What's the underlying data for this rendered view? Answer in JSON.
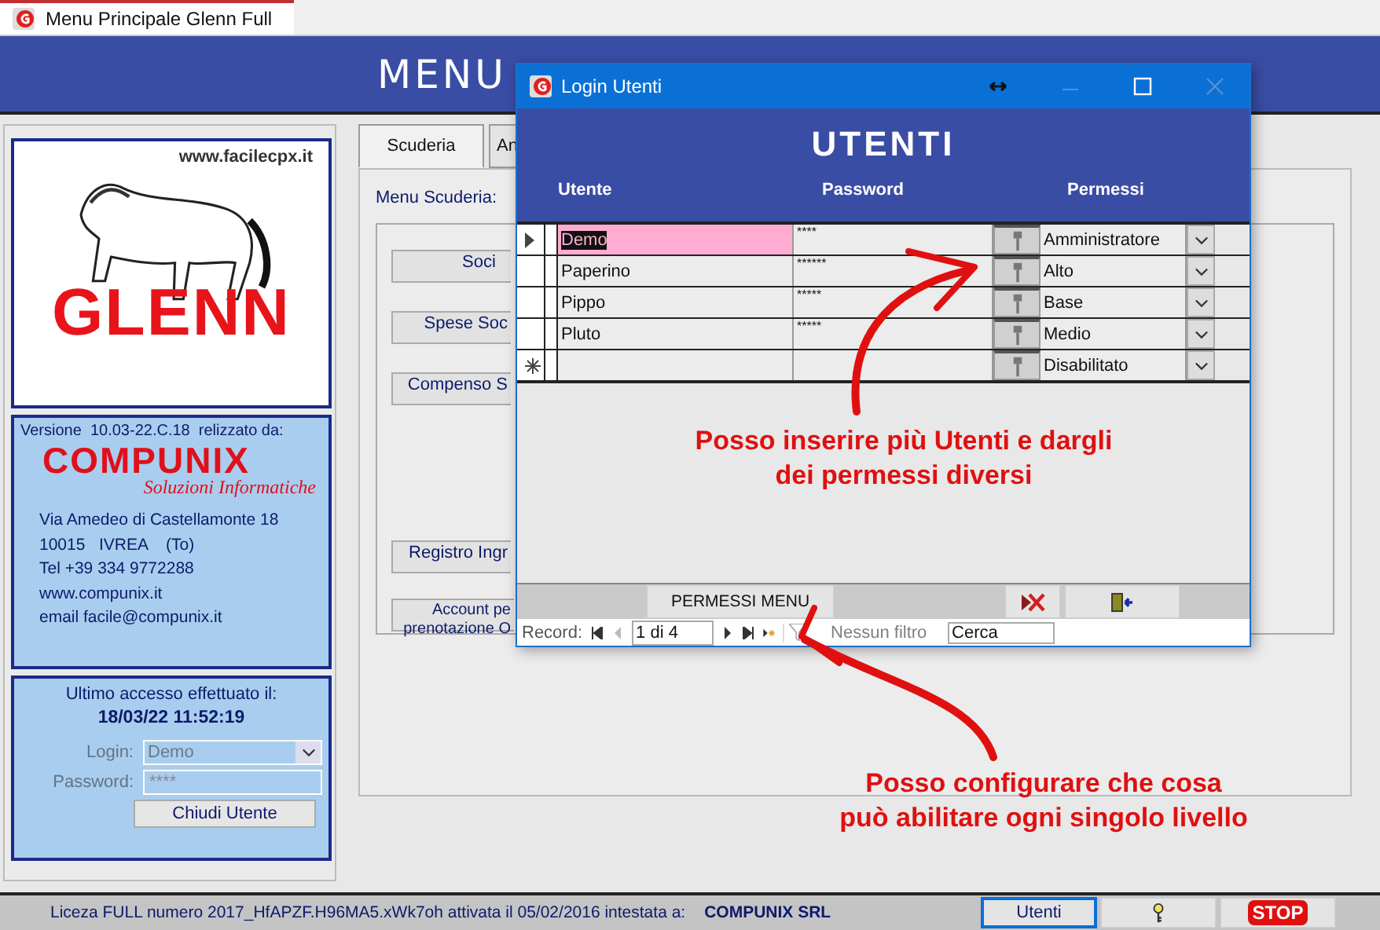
{
  "window": {
    "tab_title": "Menu Principale Glenn Full",
    "header": "MENU"
  },
  "sidebar": {
    "logo": {
      "url": "www.facilecpx.it",
      "name": "GLENN"
    },
    "info": {
      "version": "Versione  10.03-22.C.18  relizzato da:",
      "company": "COMPUNIX",
      "tagline": "Soluzioni Informatiche",
      "address_lines": [
        "Via Amedeo di Castellamonte 18",
        "10015   IVREA    (To)",
        "Tel +39 334 9772288",
        "www.compunix.it",
        "email facile@compunix.it"
      ]
    },
    "last_access": {
      "label": "Ultimo accesso effettuato il:",
      "datetime": "18/03/22 11:52:19",
      "login_label": "Login:",
      "login_value": "Demo",
      "password_label": "Password:",
      "password_value": "****",
      "disabled": true,
      "close_button": "Chiudi Utente"
    }
  },
  "tabs": [
    {
      "label": "Scuderia",
      "selected": true
    },
    {
      "label": "An",
      "selected": false
    }
  ],
  "menu": {
    "title": "Menu Scuderia:",
    "buttons": [
      {
        "lines": [
          "Soci"
        ]
      },
      {
        "lines": [
          "Spese Soc"
        ]
      },
      {
        "lines": [
          "Compenso S"
        ]
      },
      {
        "lines": [
          "Registro Ingr"
        ]
      },
      {
        "lines": [
          "Account pe",
          "prenotazione O"
        ]
      }
    ]
  },
  "dialog": {
    "title": "Login Utenti",
    "heading": "UTENTI",
    "columns": [
      "Utente",
      "Password",
      "Permessi"
    ],
    "rows": [
      {
        "user": "Demo",
        "password": "****",
        "permission": "Amministratore",
        "selected": true
      },
      {
        "user": "Paperino",
        "password": "******",
        "permission": "Alto",
        "selected": false
      },
      {
        "user": "Pippo",
        "password": "*****",
        "permission": "Base",
        "selected": false
      },
      {
        "user": "Pluto",
        "password": "*****",
        "permission": "Medio",
        "selected": false
      }
    ],
    "new_row": {
      "permission": "Disabilitato"
    },
    "footer_button": "PERMESSI MENU",
    "nav": {
      "label": "Record:",
      "position": "1 di 4",
      "filter": "Nessun filtro",
      "search_placeholder": "Cerca"
    }
  },
  "annotations": [
    {
      "lines": [
        "Posso inserire più Utenti e dargli",
        "dei permessi diversi"
      ]
    },
    {
      "lines": [
        "Posso configurare che cosa",
        "può abilitare ogni singolo livello"
      ]
    }
  ],
  "status_bar": {
    "license": "Liceza FULL numero 2017_HfAPZF.H96MA5.xWk7oh attivata il 05/02/2016 intestata a:",
    "owner": "COMPUNIX SRL",
    "buttons": [
      {
        "kind": "text",
        "label": "Utenti",
        "selected": true
      },
      {
        "kind": "key",
        "selected": false
      },
      {
        "kind": "stop",
        "label": "STOP",
        "selected": false
      }
    ]
  }
}
